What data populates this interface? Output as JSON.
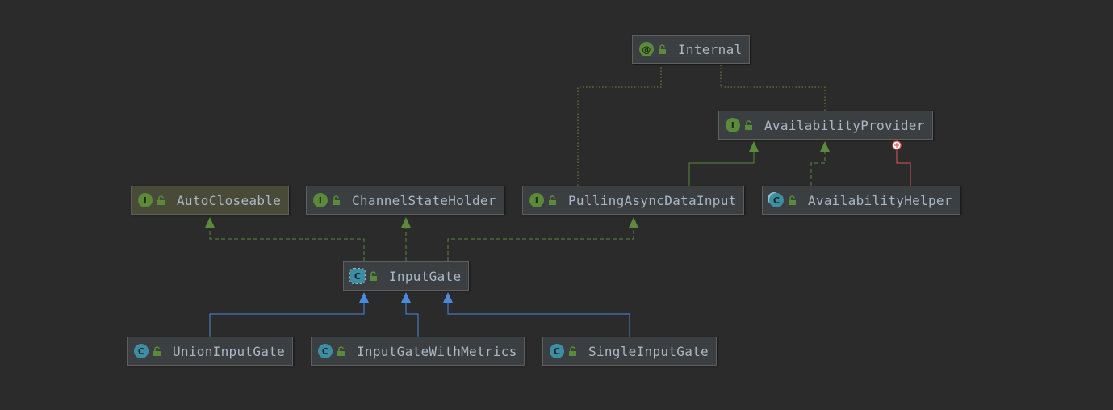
{
  "colors": {
    "background": "#2b2b2b",
    "node_fill": "#3c3f41",
    "node_border": "#5e6060",
    "text": "#a9b7c6",
    "implements_edge": "#5a8a3a",
    "extends_edge": "#4a89dc",
    "annotation_edge": "#7a8a3a",
    "inner_class_edge": "#e05555"
  },
  "nodes": {
    "internal": {
      "label": "Internal",
      "kind": "annotation",
      "kind_glyph": "@",
      "icon": "annotation-icon"
    },
    "availability_provider": {
      "label": "AvailabilityProvider",
      "kind": "interface",
      "kind_glyph": "I",
      "icon": "interface-icon"
    },
    "auto_closeable": {
      "label": "AutoCloseable",
      "kind": "interface",
      "kind_glyph": "I",
      "icon": "interface-icon"
    },
    "channel_state_holder": {
      "label": "ChannelStateHolder",
      "kind": "interface",
      "kind_glyph": "I",
      "icon": "interface-icon"
    },
    "pulling_async_data_input": {
      "label": "PullingAsyncDataInput",
      "kind": "interface",
      "kind_glyph": "I",
      "icon": "interface-icon"
    },
    "availability_helper": {
      "label": "AvailabilityHelper",
      "kind": "class",
      "kind_glyph": "C",
      "icon": "static-class-icon"
    },
    "input_gate": {
      "label": "InputGate",
      "kind": "abstract-class",
      "kind_glyph": "C",
      "icon": "abstract-class-icon"
    },
    "union_input_gate": {
      "label": "UnionInputGate",
      "kind": "class",
      "kind_glyph": "C",
      "icon": "class-icon"
    },
    "input_gate_with_metrics": {
      "label": "InputGateWithMetrics",
      "kind": "class",
      "kind_glyph": "C",
      "icon": "class-icon"
    },
    "single_input_gate": {
      "label": "SingleInputGate",
      "kind": "class",
      "kind_glyph": "C",
      "icon": "class-icon"
    }
  },
  "edges": [
    {
      "from": "union_input_gate",
      "to": "input_gate",
      "type": "extends"
    },
    {
      "from": "input_gate_with_metrics",
      "to": "input_gate",
      "type": "extends"
    },
    {
      "from": "single_input_gate",
      "to": "input_gate",
      "type": "extends"
    },
    {
      "from": "input_gate",
      "to": "auto_closeable",
      "type": "implements"
    },
    {
      "from": "input_gate",
      "to": "channel_state_holder",
      "type": "implements"
    },
    {
      "from": "input_gate",
      "to": "pulling_async_data_input",
      "type": "implements"
    },
    {
      "from": "pulling_async_data_input",
      "to": "availability_provider",
      "type": "extends-interface"
    },
    {
      "from": "availability_helper",
      "to": "availability_provider",
      "type": "implements"
    },
    {
      "from": "availability_helper",
      "to": "availability_provider",
      "type": "inner-class"
    },
    {
      "from": "pulling_async_data_input",
      "to": "internal",
      "type": "annotated-by"
    },
    {
      "from": "availability_provider",
      "to": "internal",
      "type": "annotated-by"
    }
  ]
}
